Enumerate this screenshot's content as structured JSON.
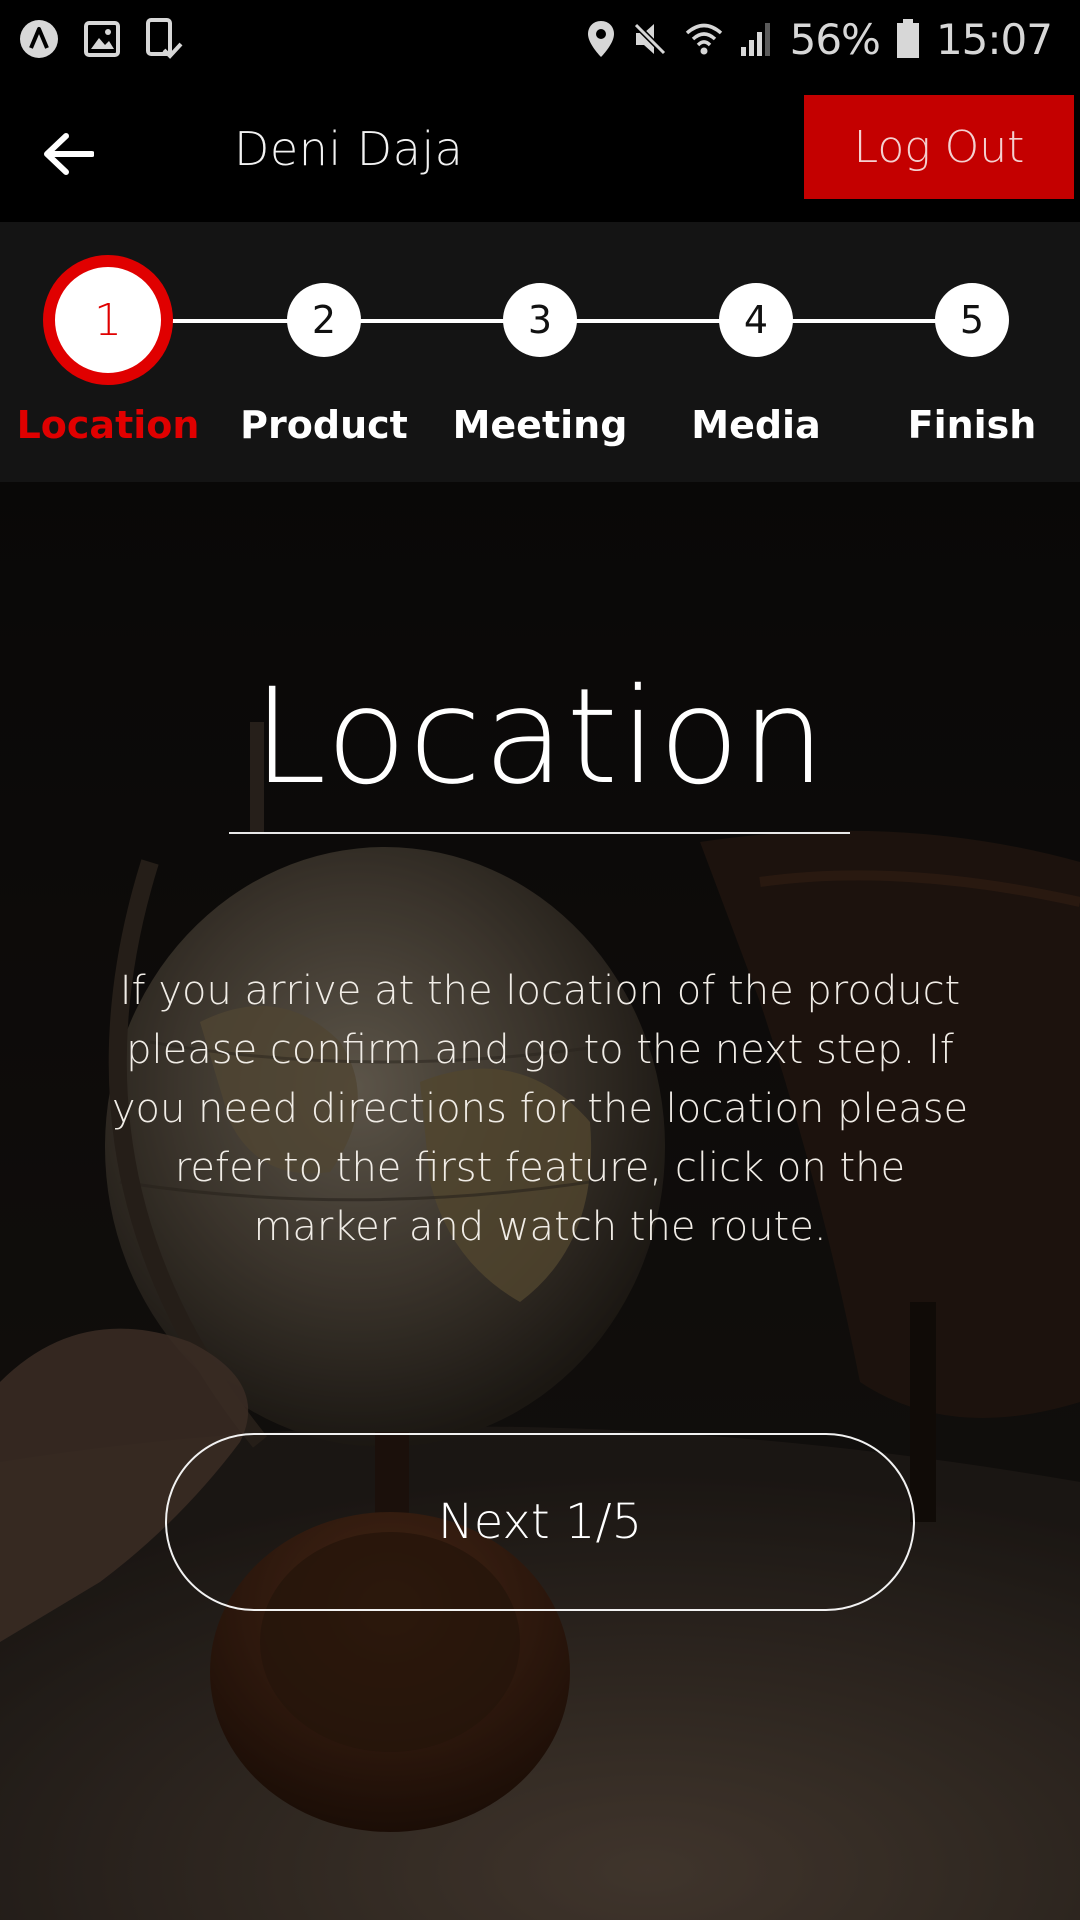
{
  "status_bar": {
    "battery_percent": "56%",
    "time": "15:07",
    "icons": [
      "app-icon",
      "image-icon",
      "phone-check-icon",
      "location-icon",
      "mute-icon",
      "wifi-icon",
      "signal-icon",
      "battery-icon"
    ]
  },
  "header": {
    "user_name": "Deni Daja",
    "logout_label": "Log Out",
    "back_icon": "arrow-left-icon"
  },
  "stepper": {
    "steps": [
      {
        "number": "1",
        "label": "Location",
        "active": true
      },
      {
        "number": "2",
        "label": "Product",
        "active": false
      },
      {
        "number": "3",
        "label": "Meeting",
        "active": false
      },
      {
        "number": "4",
        "label": "Media",
        "active": false
      },
      {
        "number": "5",
        "label": "Finish",
        "active": false
      }
    ]
  },
  "content": {
    "title": "Location",
    "instructions": "If you arrive at the location of the product please confirm and go to the next step. If you need directions for the location please refer to the first feature, click on the marker and watch the route.",
    "next_label": "Next 1/5"
  },
  "colors": {
    "accent": "#e00000",
    "logout_bg": "#c40000",
    "background": "#000000",
    "stepper_bg": "#141414"
  }
}
